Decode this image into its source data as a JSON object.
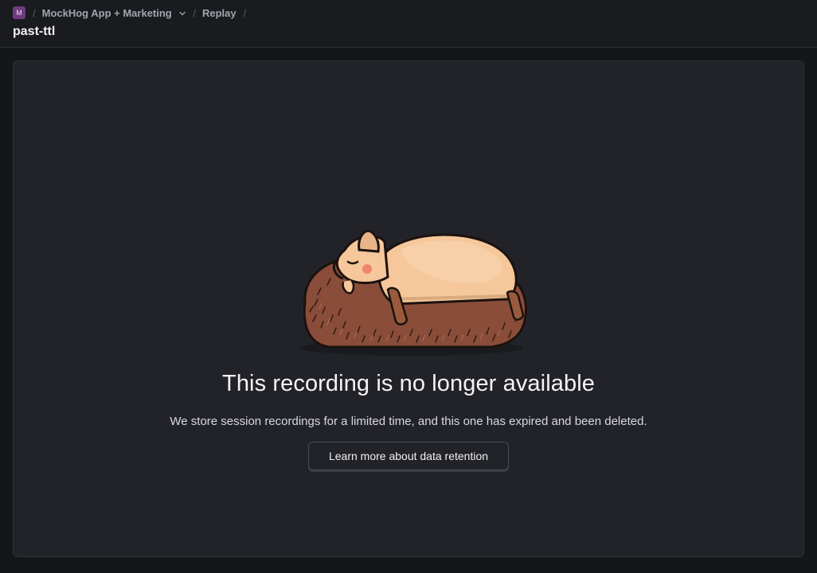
{
  "header": {
    "project_avatar": "M",
    "breadcrumb_separator": "/",
    "project_name": "MockHog App + Marketing",
    "section": "Replay",
    "title": "past-ttl"
  },
  "main": {
    "illustration": "sleeping-hedgehog-illustration",
    "headline": "This recording is no longer available",
    "description": "We store session recordings for a limited time, and this one has expired and been deleted.",
    "learn_more_label": "Learn more about data retention"
  },
  "colors": {
    "background": "#151619",
    "card": "#222328",
    "avatar": "#6e3b7e",
    "hedgehog_body": "#f5c79a",
    "hedgehog_spikes": "#8a4d3a"
  }
}
